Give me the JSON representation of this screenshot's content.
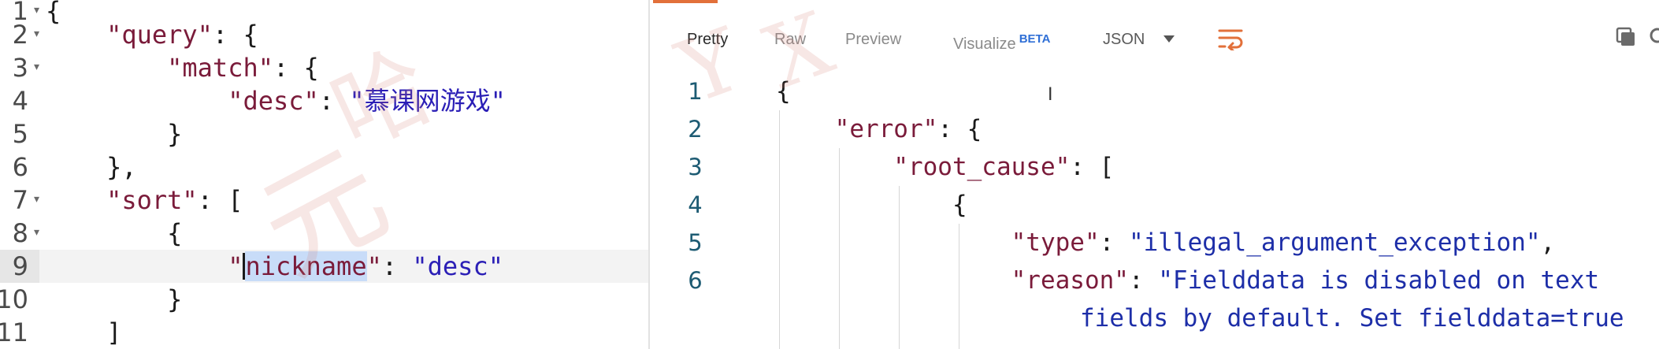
{
  "request_editor": {
    "lines": [
      {
        "num": "1",
        "fold": true
      },
      {
        "num": "2",
        "fold": true
      },
      {
        "num": "3",
        "fold": true
      },
      {
        "num": "4",
        "fold": false
      },
      {
        "num": "5",
        "fold": false
      },
      {
        "num": "6",
        "fold": false
      },
      {
        "num": "7",
        "fold": true
      },
      {
        "num": "8",
        "fold": true
      },
      {
        "num": "9",
        "fold": false
      },
      {
        "num": "10",
        "fold": false
      },
      {
        "num": "11",
        "fold": false
      }
    ],
    "tokens": {
      "open_brace": "{",
      "query_key": "\"query\"",
      "match_key": "\"match\"",
      "desc_key": "\"desc\"",
      "desc_value": "\"慕课网游戏\"",
      "close_brace": "}",
      "close_brace_comma": "},",
      "sort_key": "\"sort\"",
      "open_bracket": "[",
      "close_bracket": "]",
      "nickname_quote_open": "\"",
      "nickname_first_char": "n",
      "nickname_rest": "ickname",
      "nickname_quote_close": "\"",
      "nickname_value": "\"desc\"",
      "colon_brace": ": {",
      "colon_space": ": ",
      "colon_bracket": ": ["
    }
  },
  "response_panel": {
    "tabs": [
      {
        "label": "Pretty",
        "active": true
      },
      {
        "label": "Raw",
        "active": false
      },
      {
        "label": "Preview",
        "active": false
      },
      {
        "label": "Visualize",
        "active": false,
        "badge": "BETA"
      }
    ],
    "format": "JSON",
    "icons": [
      "wrap-lines-icon",
      "copy-icon",
      "search-icon",
      "chevron-down-icon"
    ],
    "line_numbers": [
      "1",
      "2",
      "3",
      "4",
      "5",
      "6"
    ],
    "tokens": {
      "open_brace": "{",
      "error_key": "\"error\"",
      "root_cause_key": "\"root_cause\"",
      "type_key": "\"type\"",
      "type_value": "\"illegal_argument_exception\"",
      "reason_key": "\"reason\"",
      "reason_value_l1": "\"Fielddata is disabled on text",
      "reason_value_l2": "fields by default. Set fielddata=true",
      "colon_brace": ": {",
      "colon_bracket": ": [",
      "colon_space": ": ",
      "comma": ","
    }
  },
  "colors": {
    "accent": "#e2703a",
    "key": "#7a1b3a",
    "string": "#2b1fb6",
    "line_number": "#1d5b73",
    "selection": "#c8dcf8",
    "beta_badge": "#2f6fd6"
  }
}
